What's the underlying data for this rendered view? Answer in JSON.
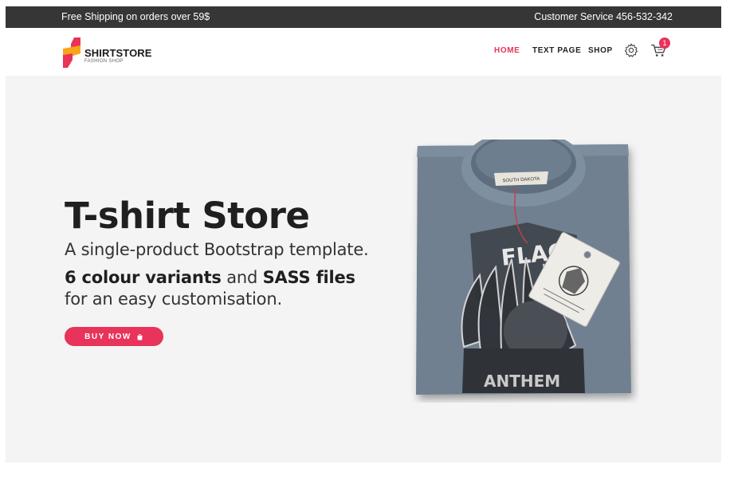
{
  "topbar": {
    "shipping_text": "Free Shipping on orders over 59$",
    "service_text": "Customer Service 456-532-342",
    "background": "#363636"
  },
  "brand": {
    "name": "SHIRTSTORE",
    "tagline": "FASHION SHOP",
    "colors": [
      "#e8335a",
      "#f7a51b"
    ]
  },
  "nav": {
    "items": [
      {
        "label": "HOME",
        "active": true
      },
      {
        "label": "TEXT PAGE",
        "active": false
      },
      {
        "label": "SHOP",
        "active": false
      }
    ],
    "settings_icon": "gear-icon",
    "cart_icon": "cart-icon",
    "cart_count": "1"
  },
  "hero": {
    "title": "T-shirt Store",
    "subtitle": "A single-product Bootstrap template.",
    "line2_bold_a": "6 colour variants",
    "line2_mid": " and ",
    "line2_bold_b": "SASS files",
    "line3": "for an easy customisation.",
    "button_label": "BUY NOW",
    "button_icon": "shopping-bag-icon",
    "accent": "#e8335a",
    "background": "#f4f4f4"
  },
  "product_image": {
    "description_icon": "folded-tshirt-image",
    "print_text": "FLAG",
    "print_text_bottom": "ANTHEM",
    "neck_label": "SOUTH DAKOTA"
  }
}
